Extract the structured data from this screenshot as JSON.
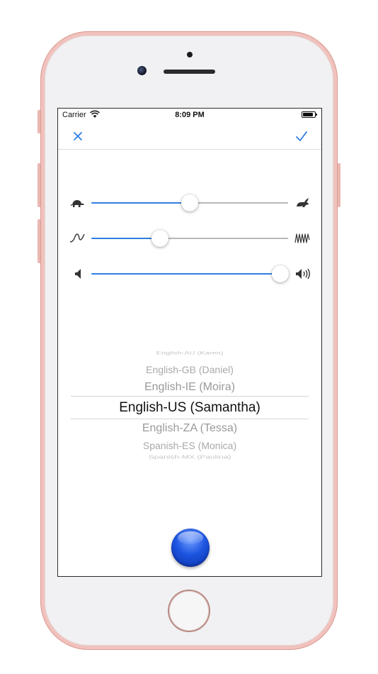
{
  "status_bar": {
    "carrier": "Carrier",
    "time": "8:09 PM"
  },
  "nav": {
    "cancel_icon": "close-icon",
    "done_icon": "checkmark-icon"
  },
  "sliders": [
    {
      "name": "rate",
      "left_icon": "turtle-icon",
      "right_icon": "rabbit-icon",
      "value": 0.5
    },
    {
      "name": "pitch",
      "left_icon": "low-pitch-wave-icon",
      "right_icon": "high-pitch-wave-icon",
      "value": 0.35
    },
    {
      "name": "volume",
      "left_icon": "speaker-low-icon",
      "right_icon": "speaker-high-icon",
      "value": 0.96
    }
  ],
  "picker": {
    "items": [
      "English-AU (Karen)",
      "English-GB (Daniel)",
      "English-IE (Moira)",
      "English-US (Samantha)",
      "English-ZA (Tessa)",
      "Spanish-ES (Monica)",
      "Spanish-MX (Paulina)"
    ],
    "selected": "English-US (Samantha)"
  },
  "colors": {
    "accent": "#2f7ee0",
    "record": "#1d55e0",
    "frame": "#f1c2bd"
  }
}
